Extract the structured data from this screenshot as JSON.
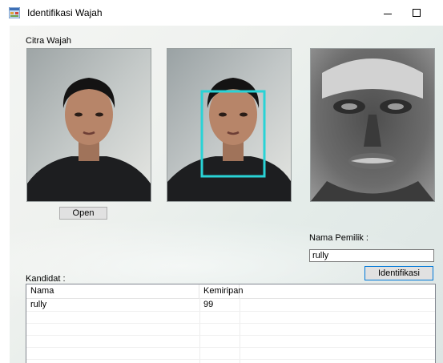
{
  "window": {
    "title": "Identifikasi Wajah"
  },
  "labels": {
    "citra_wajah": "Citra Wajah",
    "nama_pemilik": "Nama Pemilik :",
    "kandidat": "Kandidat :"
  },
  "buttons": {
    "open": "Open",
    "identifikasi": "Identifikasi"
  },
  "name_input": {
    "value": "rully"
  },
  "candidates": {
    "columns": [
      "Nama",
      "Kemiripan",
      ""
    ],
    "rows": [
      [
        "rully",
        "99",
        ""
      ]
    ]
  },
  "colors": {
    "detection_box": "#29d3d6",
    "button_focus_border": "#0078d7"
  },
  "icons": {
    "app": "form-icon",
    "minimize": "minimize-icon",
    "maximize": "maximize-icon"
  }
}
